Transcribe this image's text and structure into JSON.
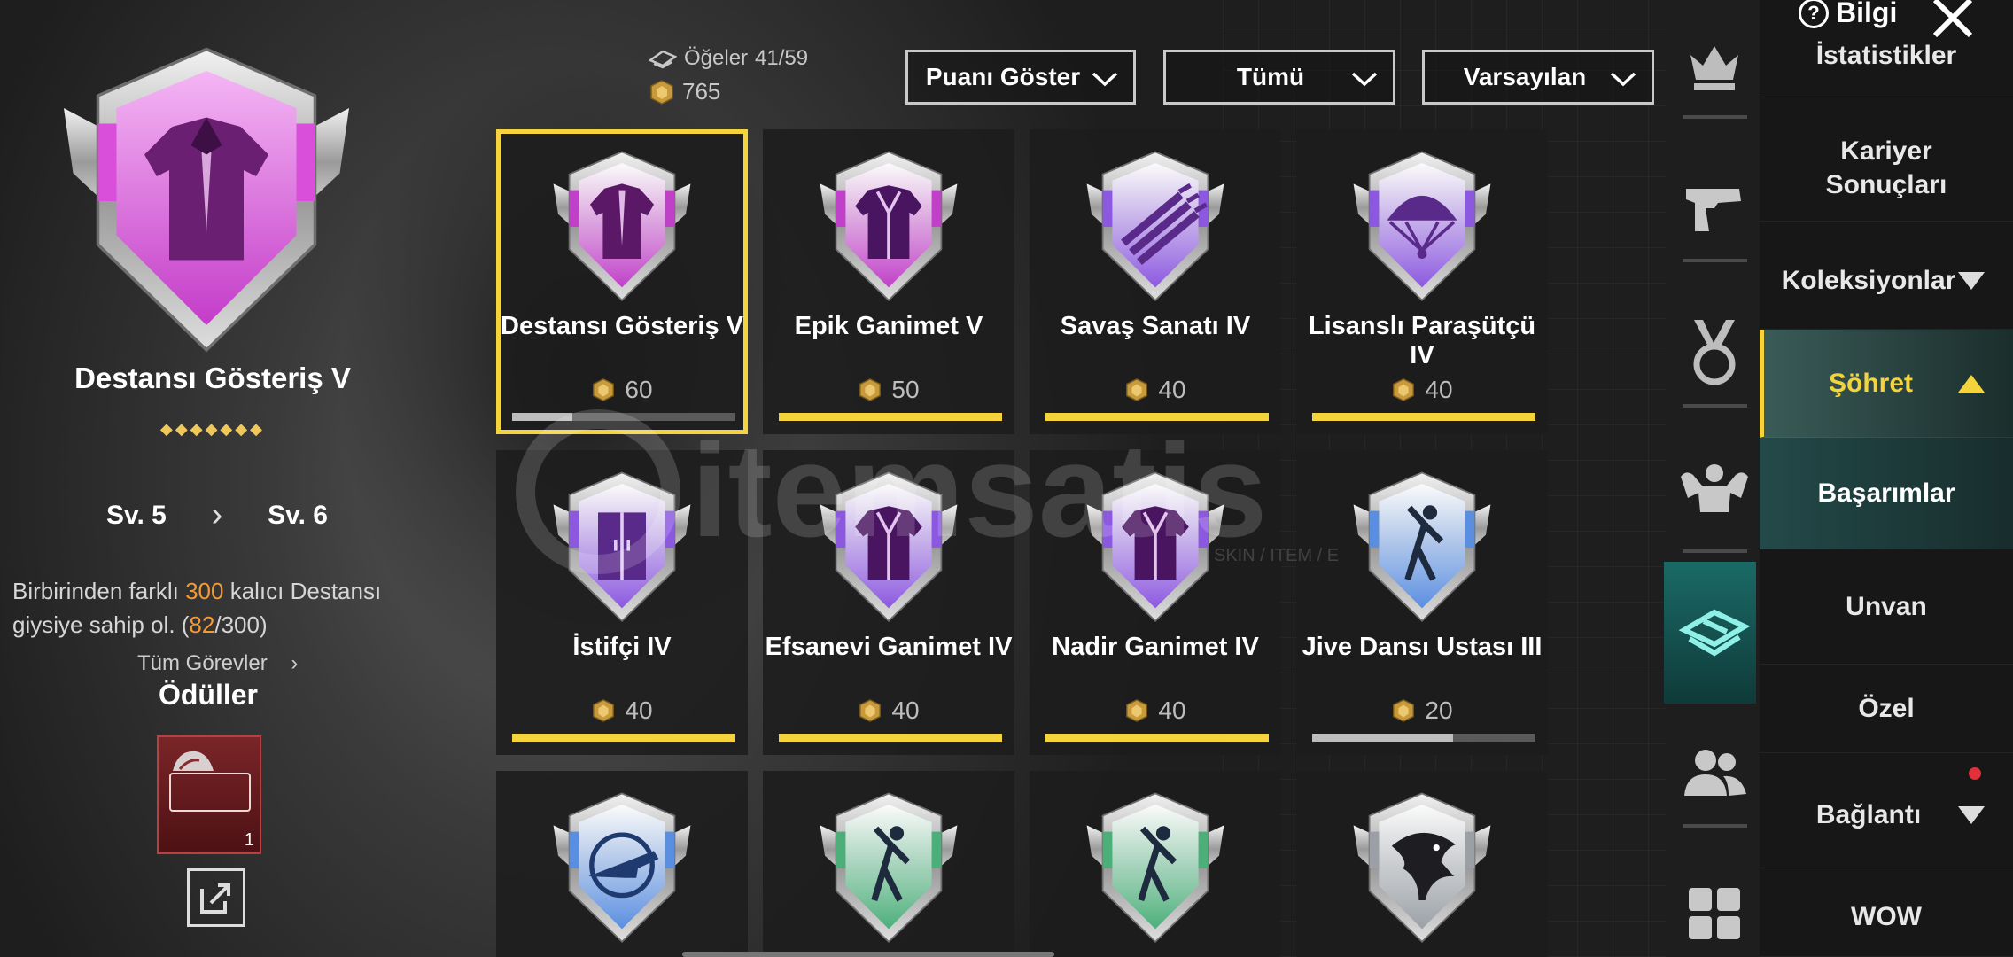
{
  "header": {
    "info_label": "Bilgi",
    "close_icon": "close-icon",
    "items_label": "Öğeler",
    "items_value": "41/59",
    "points_total": "765"
  },
  "filters": {
    "show_points": "Puanı Göster",
    "category": "Tümü",
    "sort": "Varsayılan"
  },
  "detail": {
    "name": "Destansı Gösteriş V",
    "stars": "◆◆◆◆◆◆◆",
    "level_from": "Sv. 5",
    "level_to": "Sv. 6",
    "desc_pre": "Birbirinden farklı ",
    "desc_highlight": "300",
    "desc_mid": " kalıcı Destansı giysiye sahip ol. (",
    "desc_progress": "82",
    "desc_post": "/300)",
    "all_tasks": "Tüm Görevler",
    "rewards_title": "Ödüller",
    "reward_qty": "1",
    "colors": {
      "highlight": "#f29a36",
      "accent": "#f5d33c"
    }
  },
  "achievements": [
    {
      "name": "Destansı Gösteriş V",
      "points": "60",
      "progress": 0.27,
      "bar": "grey",
      "color": "#c040c8",
      "icon": "jacket-icon",
      "selected": true
    },
    {
      "name": "Epik Ganimet V",
      "points": "50",
      "progress": 1.0,
      "bar": "gold",
      "color": "#c040c8",
      "icon": "coat-icon"
    },
    {
      "name": "Savaş Sanatı IV",
      "points": "40",
      "progress": 1.0,
      "bar": "gold",
      "color": "#8c58e0",
      "icon": "claw-slash-icon"
    },
    {
      "name": "Lisanslı Paraşütçü IV",
      "points": "40",
      "progress": 1.0,
      "bar": "gold",
      "color": "#8c58e0",
      "icon": "parachute-icon"
    },
    {
      "name": "İstifçi IV",
      "points": "40",
      "progress": 1.0,
      "bar": "gold",
      "color": "#8c58e0",
      "icon": "wardrobe-icon"
    },
    {
      "name": "Efsanevi Ganimet IV",
      "points": "40",
      "progress": 1.0,
      "bar": "gold",
      "color": "#8c58e0",
      "icon": "coat-icon"
    },
    {
      "name": "Nadir Ganimet IV",
      "points": "40",
      "progress": 1.0,
      "bar": "gold",
      "color": "#8c58e0",
      "icon": "coat-icon"
    },
    {
      "name": "Jive Dansı Ustası III",
      "points": "20",
      "progress": 0.63,
      "bar": "grey",
      "color": "#5a8ee0",
      "icon": "dancer-icon"
    },
    {
      "name": "",
      "points": "",
      "progress": null,
      "color": "#5a8ee0",
      "icon": "crosshair-gun-icon"
    },
    {
      "name": "",
      "points": "",
      "progress": null,
      "color": "#4caf7a",
      "icon": "dancer-icon"
    },
    {
      "name": "",
      "points": "",
      "progress": null,
      "color": "#4caf7a",
      "icon": "dancer-icon"
    },
    {
      "name": "",
      "points": "",
      "progress": null,
      "color": "#9aa0a6",
      "icon": "eagle-icon"
    }
  ],
  "rail": [
    {
      "icon": "crown-icon"
    },
    {
      "icon": "pistol-icon"
    },
    {
      "icon": "medal-icon"
    },
    {
      "icon": "muscle-icon"
    },
    {
      "icon": "box-icon",
      "active": true
    },
    {
      "icon": "friends-icon"
    },
    {
      "icon": "grid-icon"
    }
  ],
  "menu": {
    "statistics": "İstatistikler",
    "career_results": "Kariyer Sonuçları",
    "collections": "Koleksiyonlar",
    "fame": "Şöhret",
    "achievements": "Başarımlar",
    "title": "Unvan",
    "special": "Özel",
    "connection": "Bağlantı",
    "wow": "WOW"
  },
  "watermark": {
    "brand": "itemsatis",
    "tag": "SKIN / ITEM / E"
  }
}
